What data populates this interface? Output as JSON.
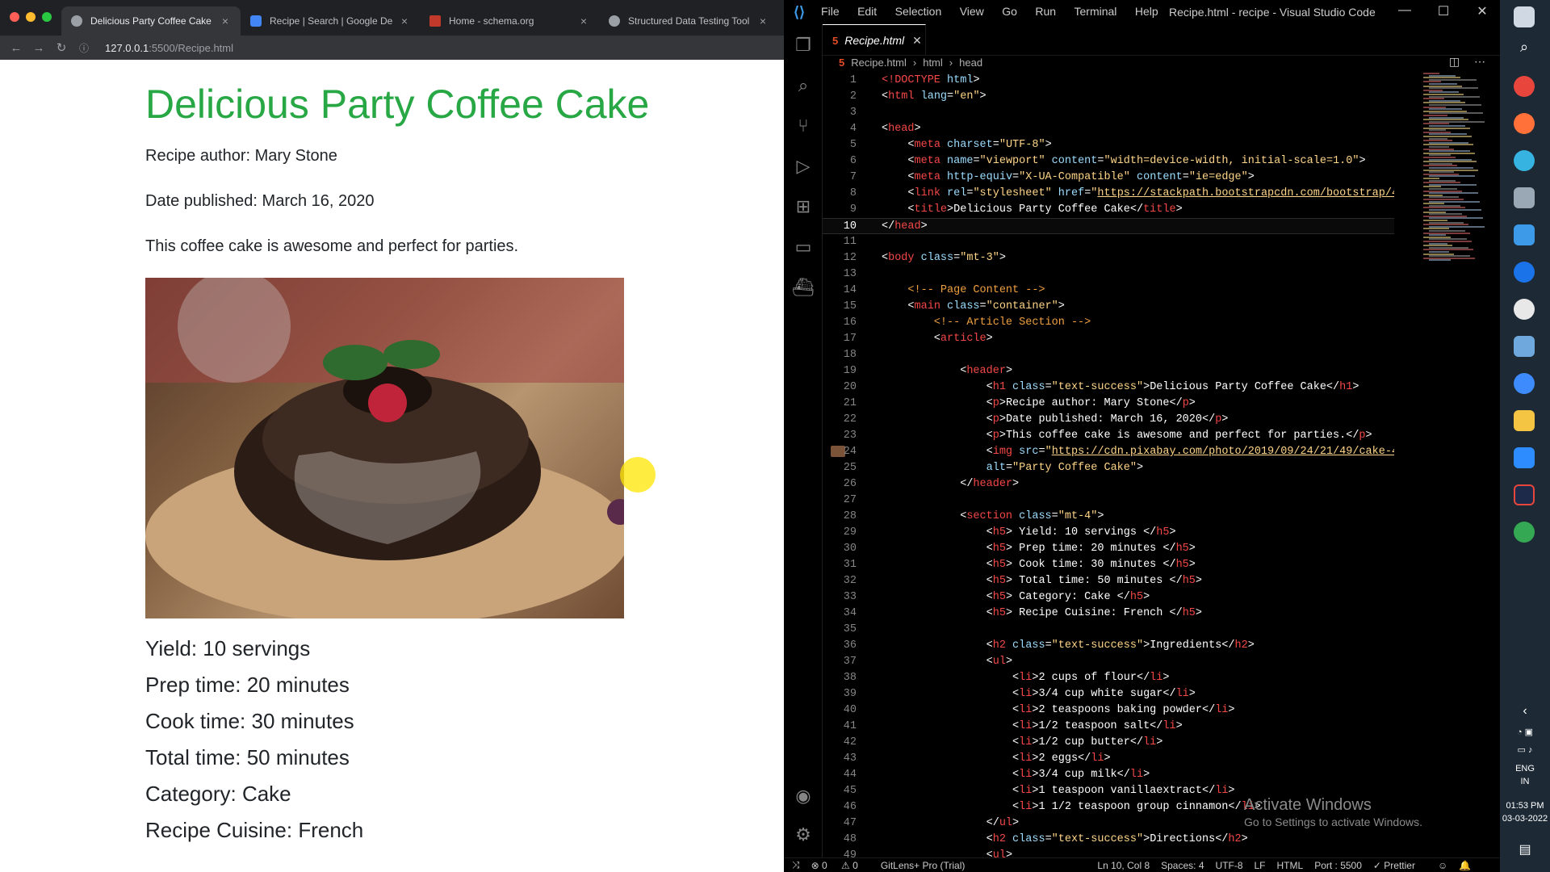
{
  "browser": {
    "tabs": [
      {
        "title": "Delicious Party Coffee Cake",
        "active": true
      },
      {
        "title": "Recipe | Search | Google De",
        "active": false
      },
      {
        "title": "Home - schema.org",
        "active": false
      },
      {
        "title": "Structured Data Testing Tool",
        "active": false
      }
    ],
    "url_host": "127.0.0.1",
    "url_path": ":5500/Recipe.html",
    "page": {
      "title": "Delicious Party Coffee Cake",
      "author": "Recipe author: Mary Stone",
      "date": "Date published: March 16, 2020",
      "description": "This coffee cake is awesome and perfect for parties.",
      "details": [
        "Yield: 10 servings",
        "Prep time: 20 minutes",
        "Cook time: 30 minutes",
        "Total time: 50 minutes",
        "Category: Cake",
        "Recipe Cuisine: French"
      ]
    }
  },
  "vscode": {
    "menu": [
      "File",
      "Edit",
      "Selection",
      "View",
      "Go",
      "Run",
      "Terminal",
      "Help"
    ],
    "window_title": "Recipe.html - recipe - Visual Studio Code",
    "tab_label": "Recipe.html",
    "breadcrumb": [
      "Recipe.html",
      "html",
      "head"
    ],
    "status": {
      "errors": "0",
      "warnings": "0",
      "gitlens": "GitLens+ Pro (Trial)",
      "position": "Ln 10, Col 8",
      "spaces": "Spaces: 4",
      "encoding": "UTF-8",
      "eol": "LF",
      "language": "HTML",
      "port": "Port : 5500",
      "prettier": "Prettier"
    },
    "watermark": {
      "title": "Activate Windows",
      "subtitle": "Go to Settings to activate Windows."
    }
  },
  "taskbar": {
    "lang": "ENG",
    "region": "IN",
    "time": "01:53 PM",
    "date": "03-03-2022"
  },
  "colors": {
    "success": "#28a745",
    "tag": "#f44747",
    "attr": "#9cdcfe",
    "string": "#ffd588",
    "comment": "#f0a040"
  }
}
